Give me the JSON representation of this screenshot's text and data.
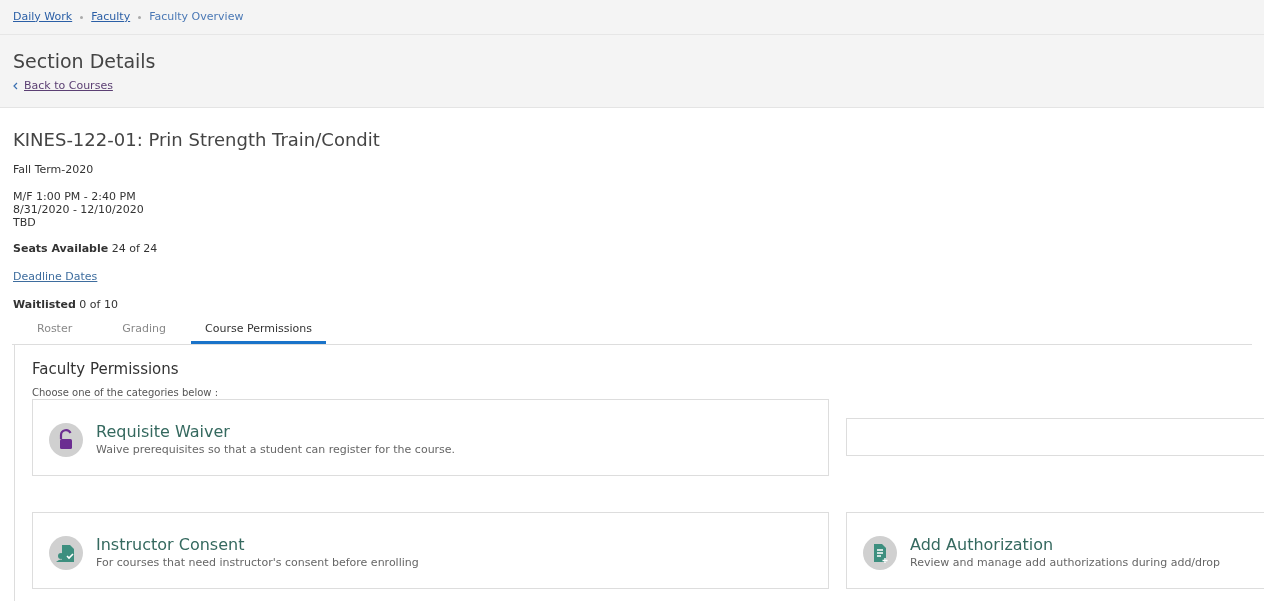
{
  "breadcrumb": [
    {
      "label": "Daily Work",
      "kind": "link"
    },
    {
      "label": "Faculty",
      "kind": "link"
    },
    {
      "label": "Faculty Overview",
      "kind": "current"
    }
  ],
  "header": {
    "title": "Section Details",
    "back_link": "Back to Courses"
  },
  "section": {
    "title": "KINES-122-01: Prin Strength Train/Condit",
    "term": "Fall Term-2020",
    "schedule": [
      "M/F 1:00 PM - 2:40 PM",
      "8/31/2020 - 12/10/2020",
      "TBD"
    ],
    "seats": "**Seats Available** 24 of 24",
    "deadline_link": "Deadline Dates",
    "waitlist": "**Waitlisted** 0 of 10"
  },
  "tabs": [
    {
      "label": "Roster",
      "selected": false
    },
    {
      "label": "Grading",
      "selected": false
    },
    {
      "label": "Course Permissions",
      "selected": true
    }
  ],
  "permissions": {
    "title": "Faculty Permissions",
    "prompt": "Choose one of the categories below :",
    "rows": [
      [
        {
          "kind": "lock",
          "title": "Requisite Waiver",
          "description": "Waive prerequisites so that a student can register for the course."
        },
        {
          "kind": "empty"
        }
      ],
      [
        {
          "kind": "consent",
          "title": "Instructor Consent",
          "description": "For courses that need instructor's consent before enrolling"
        },
        {
          "kind": "document",
          "title": "Add Authorization",
          "description": "Review and manage add authorizations during add/drop"
        }
      ]
    ]
  }
}
